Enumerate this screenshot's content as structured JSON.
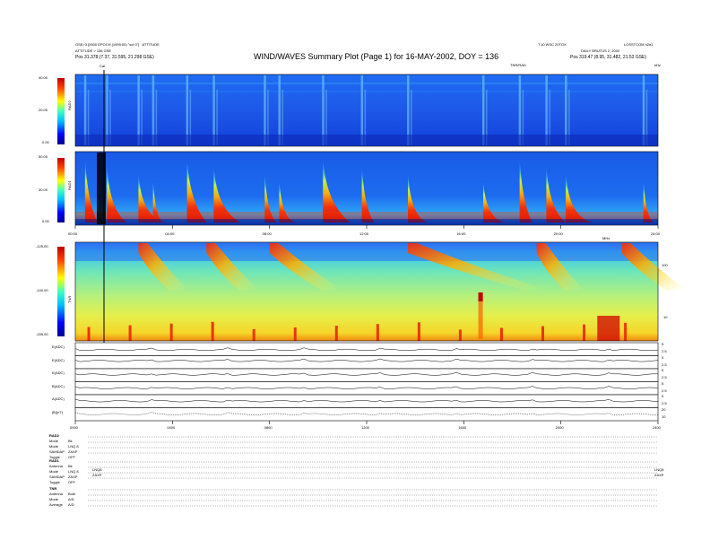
{
  "header": {
    "top_left_line1": "GSE>3 [0000 EPOCH (1999:00) \"sol 0\"] · ATTITUDE",
    "top_left_line2": "ATTITUDE > 136 GSE",
    "top_left_pos": "Pos   31.378 (7.37, 31.595, 21.298 GSE)",
    "top_right_line1": "T.10 WSC 20TOX",
    "top_right_line2": "DAILY BRUTUS 2, 2002",
    "top_right_line3": "LOSSTCOM  n2a1",
    "top_right_pos": "Pos   319.47 (8.95, 31.482, 21.53 GSE)",
    "title": "WIND/WAVES Summary Plot (Page 1) for 16-MAY-2002, DOY = 136",
    "cal_marker": "Cal",
    "top_axis_center": "TNR/RAD",
    "top_axis_right": "kHz",
    "mid_axis_right": "MHz"
  },
  "panels": {
    "rad2": {
      "name": "RAD2",
      "yticks": [
        "40.00",
        "20.00",
        "0.00"
      ]
    },
    "rad1": {
      "name": "RAD1",
      "yticks": [
        "50.00",
        "30.00",
        "0.00"
      ]
    },
    "tnr": {
      "name": "TNR",
      "yticks": [
        "-125.00",
        "-140.00",
        "-155.00"
      ],
      "right_ticks": [
        "100",
        "10"
      ]
    },
    "time_labels_top": [
      "00:00",
      "04:00",
      "08:00",
      "12:00",
      "16:00",
      "20:00",
      "24:00"
    ],
    "time_labels_bottom": [
      "0000",
      "0400",
      "0800",
      "1200",
      "1600",
      "2000",
      "2400"
    ],
    "mid_axis_unit": "MHz"
  },
  "chart_data": {
    "type": "heatmap",
    "title": "WIND/WAVES Summary Plot (Page 1) for 16-MAY-2002, DOY = 136",
    "x": {
      "unit": "hours UT",
      "range": [
        0,
        24
      ],
      "ticks": [
        "00:00",
        "04:00",
        "08:00",
        "12:00",
        "16:00",
        "20:00",
        "24:00"
      ]
    },
    "panels": [
      {
        "name": "RAD2",
        "ylim": [
          0,
          40
        ],
        "colorscale": "jet"
      },
      {
        "name": "RAD1",
        "ylim": [
          0,
          50
        ],
        "colorscale": "jet"
      },
      {
        "name": "TNR",
        "ylim": [
          -155,
          -125
        ],
        "colorscale": "jet"
      }
    ],
    "radio_bursts_hours": [
      0.4,
      1.3,
      2.6,
      3.2,
      4.6,
      5.7,
      7.8,
      8.4,
      10.2,
      11.8,
      13.7,
      16.8,
      18.3,
      19.4,
      20.2,
      23.4
    ],
    "strip_lines": [
      {
        "name": "E(ADC)",
        "level": 0.45
      },
      {
        "name": "E(ADC)",
        "level": 0.6
      },
      {
        "name": "E(ADC)",
        "level": 0.55
      },
      {
        "name": "B(ADC)",
        "level": 0.5
      },
      {
        "name": "A(ADC)",
        "level": 0.5
      },
      {
        "name": "|B|(nT)",
        "level": 0.5
      }
    ]
  },
  "strips": [
    {
      "name": "E(ADC)",
      "ticks": [
        "5",
        "2.5"
      ]
    },
    {
      "name": "E(ADC)",
      "ticks": [
        "5",
        "2.5"
      ]
    },
    {
      "name": "E(ADC)",
      "ticks": [
        "5",
        "2.5"
      ]
    },
    {
      "name": "B(ADC)",
      "ticks": [
        "5",
        "2.5"
      ]
    },
    {
      "name": "A(ADC)",
      "ticks": [
        "5",
        "2.5"
      ]
    },
    {
      "name": "|B|(nT)",
      "ticks": [
        "20",
        "10"
      ]
    }
  ],
  "footer": {
    "rad2_title": "RAD2",
    "rad2_rows": [
      {
        "label": "Mode",
        "value": "Bk"
      },
      {
        "label": "Mode",
        "value": "LNQ 8"
      },
      {
        "label": "SAMDAP",
        "value": "ZAXP"
      },
      {
        "label": "Toggle",
        "value": "OFF"
      }
    ],
    "rad1_title": "RAD1",
    "rad1_rows": [
      {
        "label": "Antenna",
        "value": "Bk"
      },
      {
        "label": "Mode",
        "value": "LNQ 8"
      },
      {
        "label": "SAMDAP",
        "value": "ZAXP"
      },
      {
        "label": "Toggle",
        "value": "OFF"
      }
    ],
    "tnr_title": "TNR",
    "tnr_rows": [
      {
        "label": "Antenna",
        "value": "Both"
      },
      {
        "label": "Mode",
        "value": "A/D"
      },
      {
        "label": "Average",
        "value": "A/D"
      }
    ],
    "mid_marker_left": "LNQ8",
    "mid_marker_left2": "ZAXP",
    "mid_marker_right": "LNQ8",
    "mid_marker_right2": "ZAXP"
  }
}
